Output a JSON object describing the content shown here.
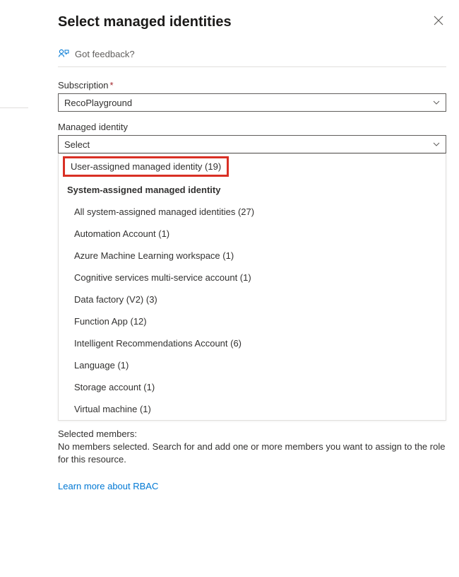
{
  "header": {
    "title": "Select managed identities"
  },
  "feedback": {
    "label": "Got feedback?"
  },
  "subscription": {
    "label": "Subscription",
    "required": "*",
    "value": "RecoPlayground"
  },
  "managedIdentity": {
    "label": "Managed identity",
    "placeholder": "Select"
  },
  "dropdown": {
    "userAssigned": "User-assigned managed identity (19)",
    "systemHeader": "System-assigned managed identity",
    "items": [
      "All system-assigned managed identities (27)",
      "Automation Account (1)",
      "Azure Machine Learning workspace (1)",
      "Cognitive services multi-service account (1)",
      "Data factory (V2) (3)",
      "Function App (12)",
      "Intelligent Recommendations Account (6)",
      "Language (1)",
      "Storage account (1)",
      "Virtual machine (1)"
    ]
  },
  "selected": {
    "label": "Selected members:",
    "noMembers": "No members selected. Search for and add one or more members you want to assign to the role for this resource."
  },
  "learnMore": "Learn more about RBAC"
}
